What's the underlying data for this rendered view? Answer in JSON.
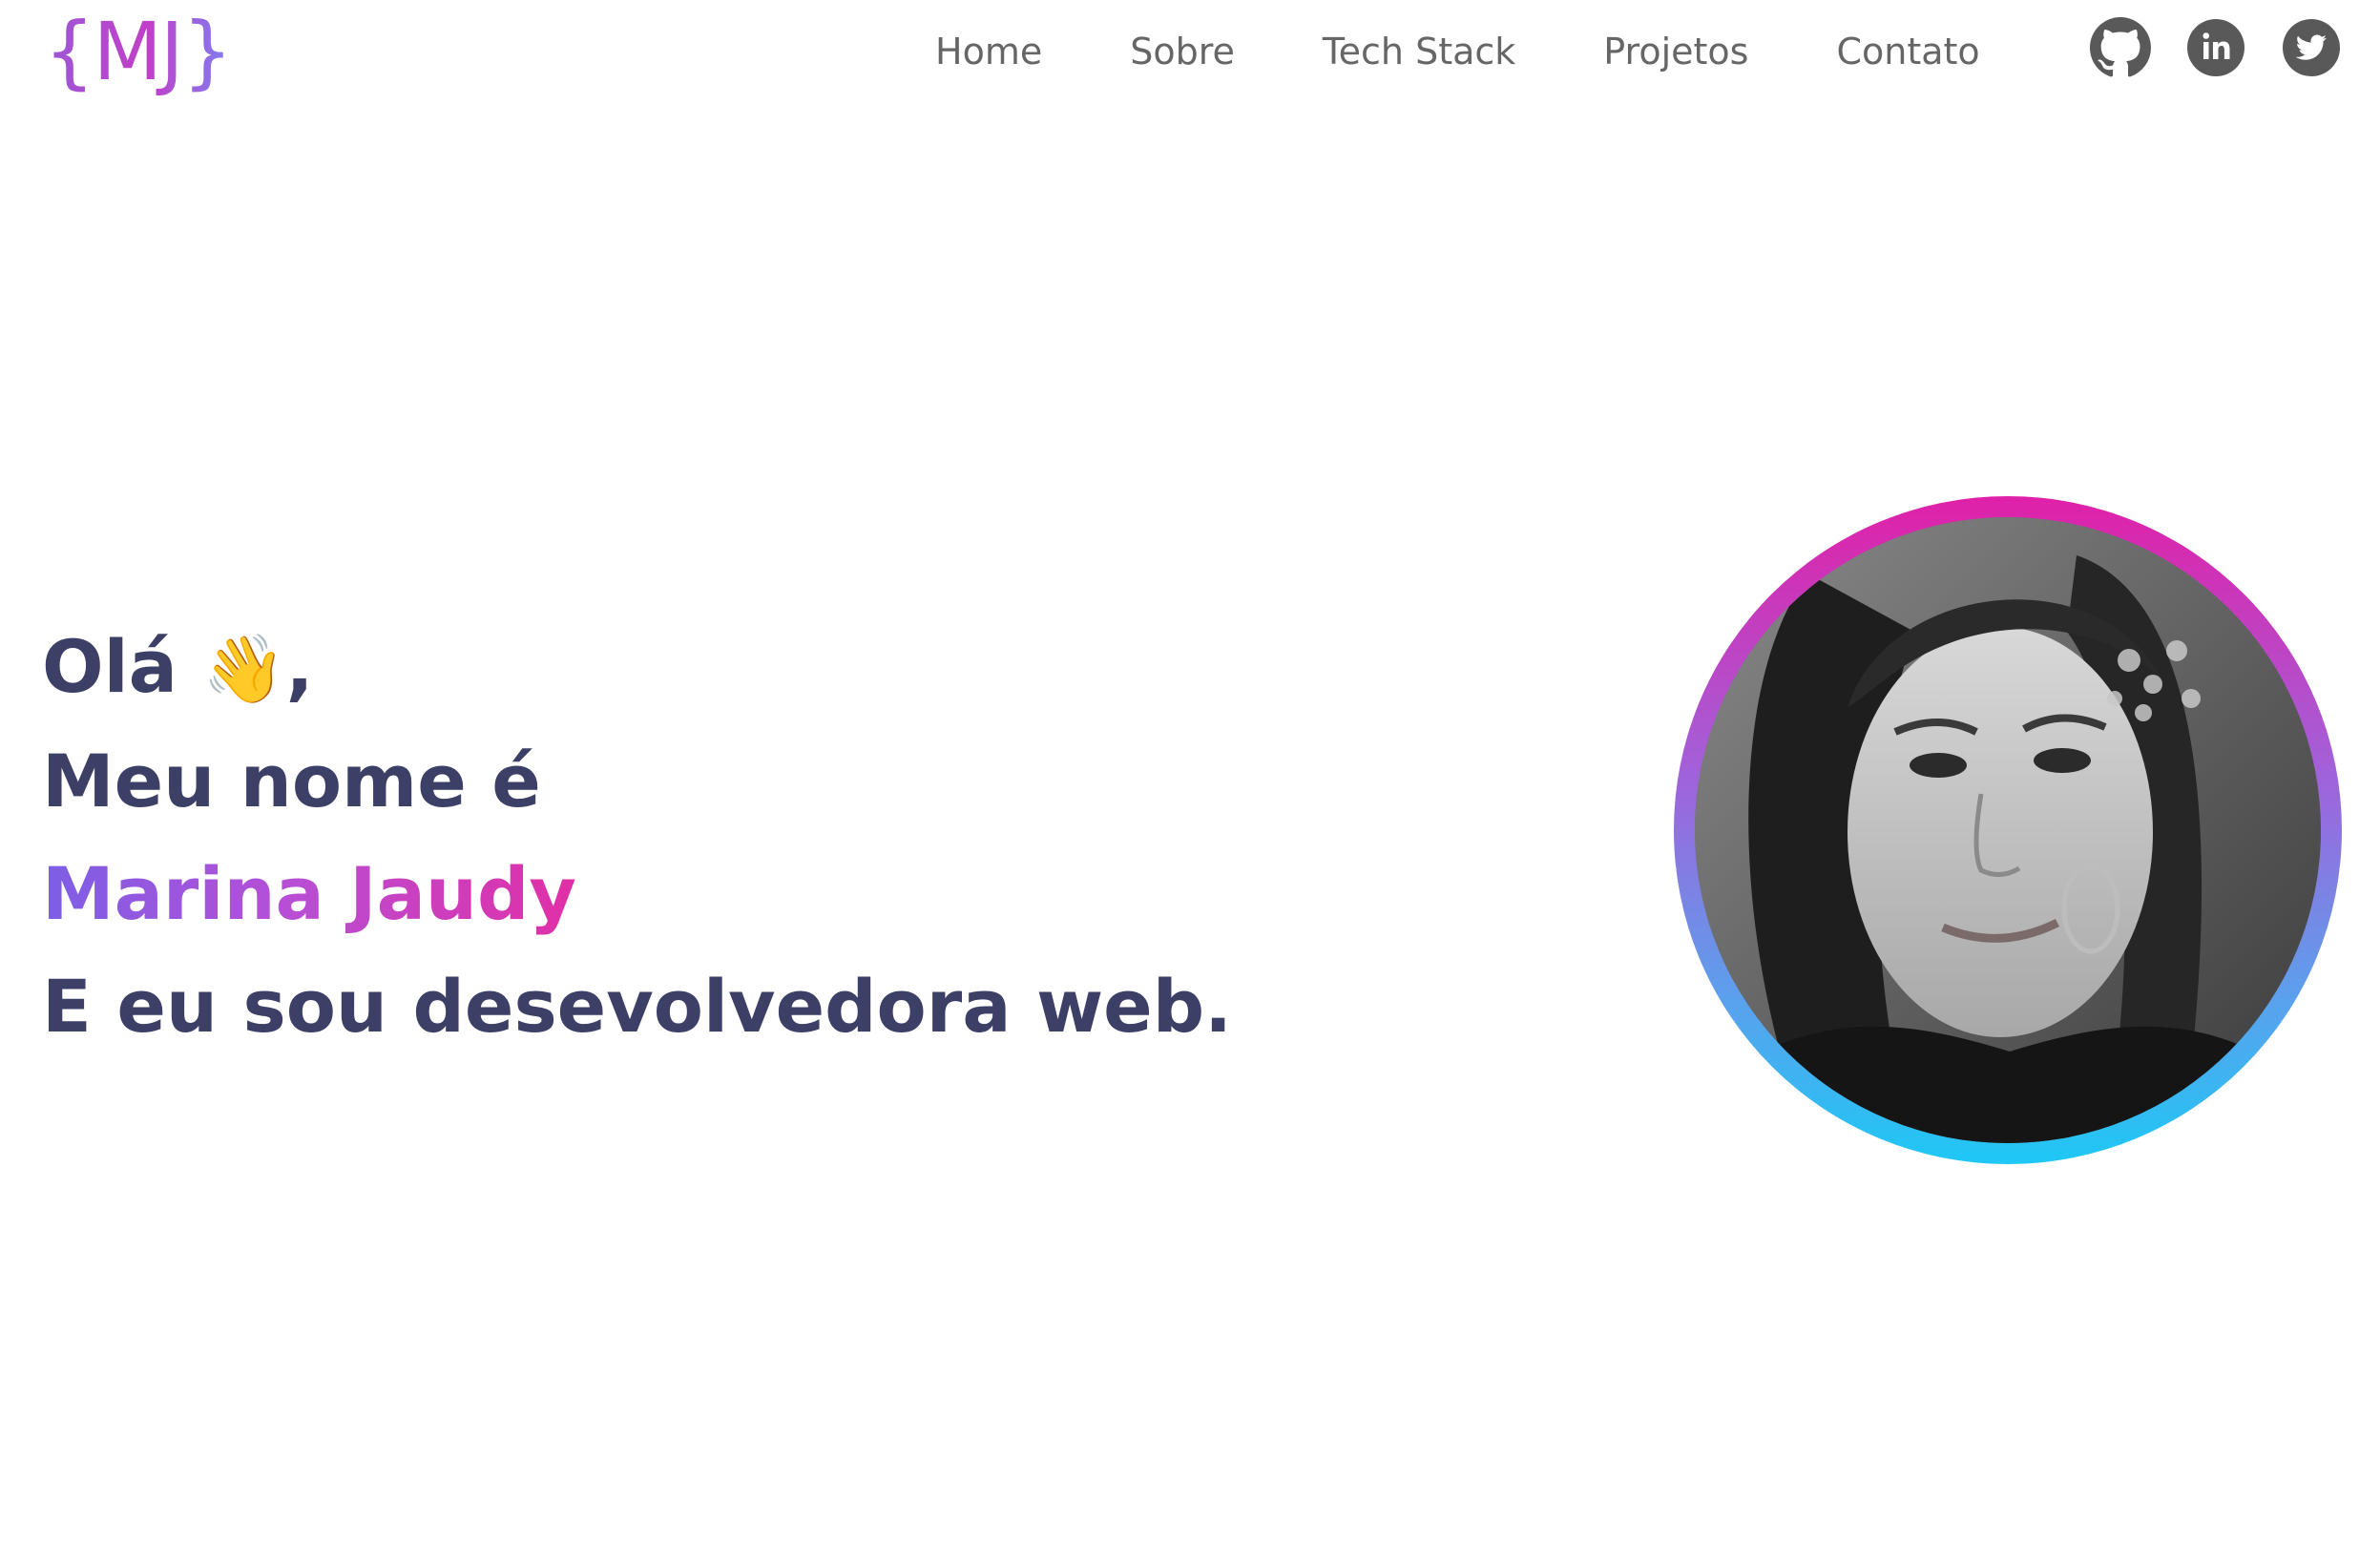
{
  "header": {
    "logo": "{MJ}",
    "nav": [
      {
        "label": "Home"
      },
      {
        "label": "Sobre"
      },
      {
        "label": "Tech Stack"
      },
      {
        "label": "Projetos"
      },
      {
        "label": "Contato"
      }
    ],
    "social": [
      {
        "icon": "github-icon"
      },
      {
        "icon": "linkedin-icon"
      },
      {
        "icon": "twitter-icon"
      }
    ]
  },
  "hero": {
    "greeting": "Olá",
    "greeting_emoji": "👋",
    "greeting_suffix": ",",
    "intro": "Meu nome é",
    "name": "Marina Jaudy",
    "role": "E eu sou desevolvedora web."
  },
  "colors": {
    "heading": "#3c3f66",
    "nav_text": "#666666",
    "icon": "#595959",
    "gradient_start": "#e020a8",
    "gradient_mid": "#a45fd8",
    "gradient_end": "#1ec8f6"
  }
}
